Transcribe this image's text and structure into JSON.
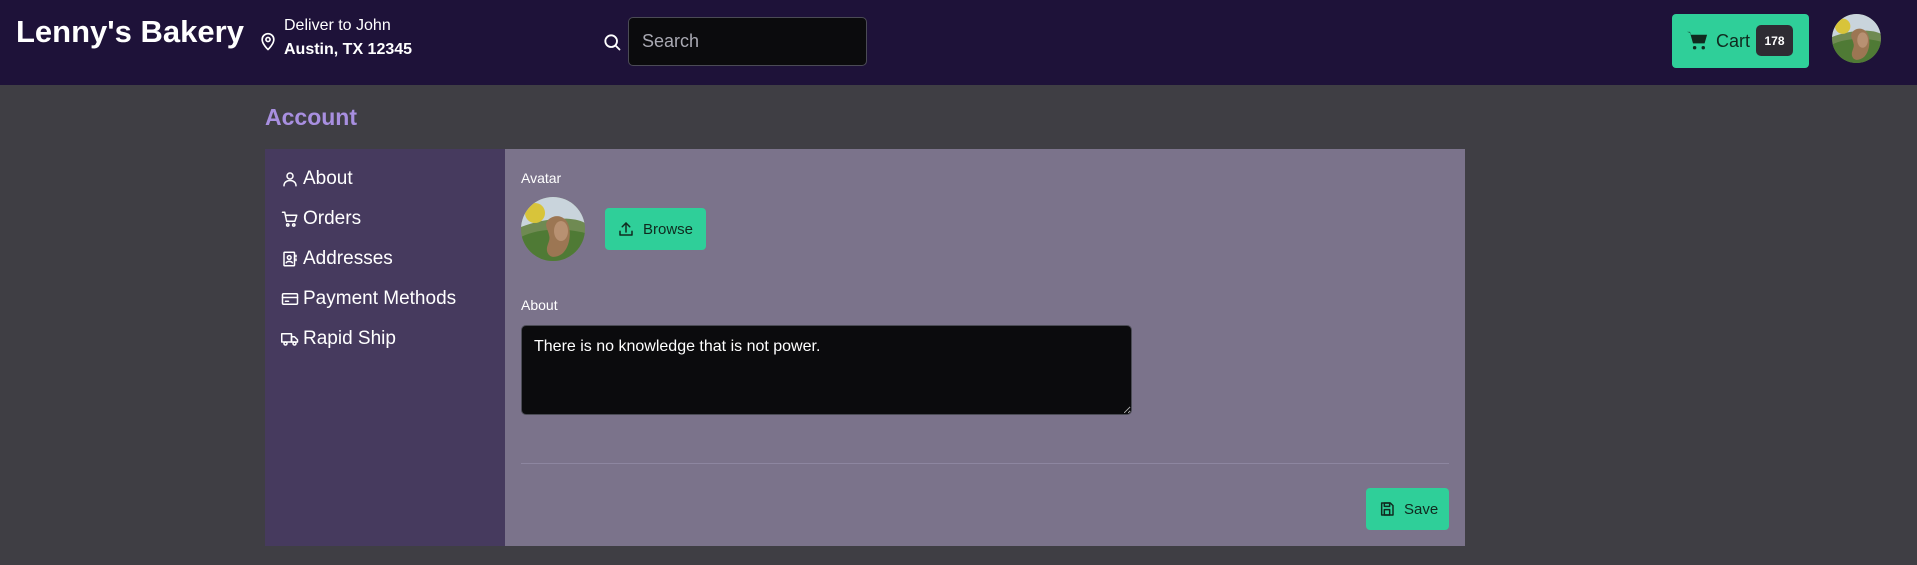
{
  "header": {
    "brand": "Lenny's Bakery",
    "deliver_line1": "Deliver to John",
    "deliver_line2": "Austin, TX 12345",
    "search_placeholder": "Search",
    "cart_label": "Cart",
    "cart_count": "178"
  },
  "page": {
    "title": "Account"
  },
  "sidebar": {
    "items": [
      {
        "label": "About",
        "icon": "user-icon"
      },
      {
        "label": "Orders",
        "icon": "cart-icon"
      },
      {
        "label": "Addresses",
        "icon": "address-book-icon"
      },
      {
        "label": "Payment Methods",
        "icon": "credit-card-icon"
      },
      {
        "label": "Rapid Ship",
        "icon": "truck-icon"
      }
    ]
  },
  "form": {
    "avatar_label": "Avatar",
    "browse_label": "Browse",
    "about_label": "About",
    "about_value": "There is no knowledge that is not power.",
    "save_label": "Save"
  },
  "colors": {
    "topbar": "#1e1239",
    "accent": "#2fcf99",
    "title": "#a88fe0",
    "sidebar": "#463a5e",
    "panel": "#7b738b"
  }
}
